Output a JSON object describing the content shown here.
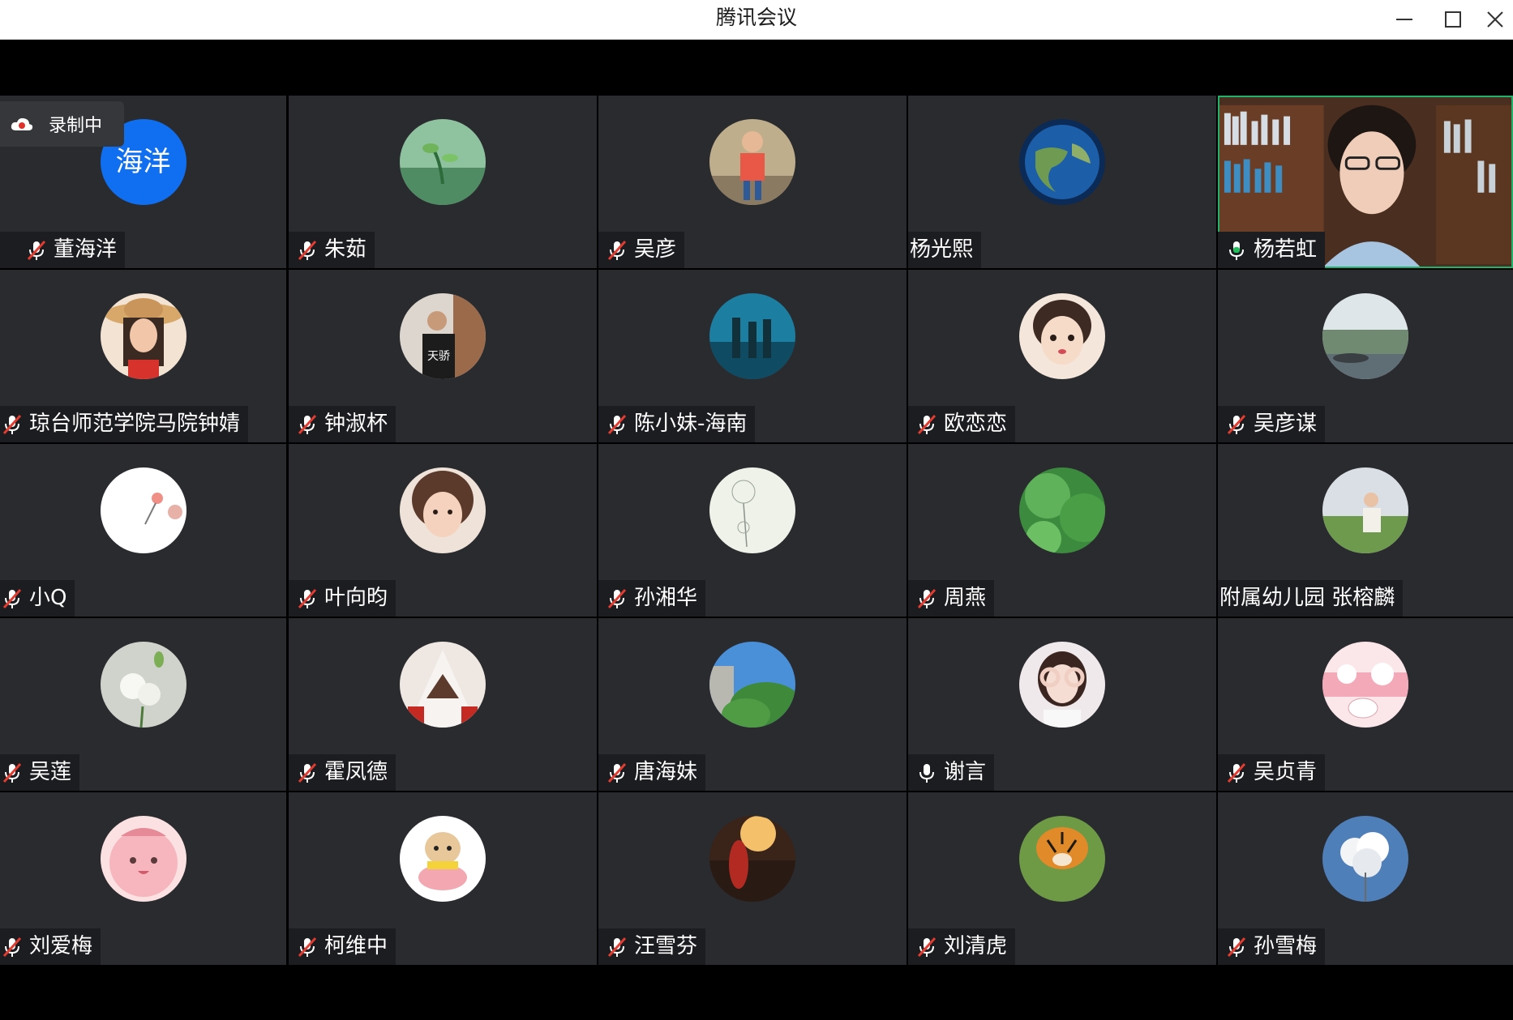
{
  "window": {
    "title": "腾讯会议"
  },
  "recording": {
    "label": "录制中"
  },
  "participants": [
    {
      "name": "董海洋",
      "mic": "muted",
      "avatar": "text-avatar",
      "avatar_text": "海洋",
      "avatar_color": "#0f6ff0"
    },
    {
      "name": "朱茹",
      "mic": "muted",
      "avatar": "plant-photo"
    },
    {
      "name": "吴彦",
      "mic": "muted",
      "avatar": "child-photo"
    },
    {
      "name": "杨光熙",
      "mic": "none",
      "avatar": "earth-photo"
    },
    {
      "name": "杨若虹",
      "mic": "speaking",
      "avatar": "video-feed"
    },
    {
      "name": "琼台师范学院马院钟婧",
      "mic": "muted",
      "avatar": "woman-hat-photo"
    },
    {
      "name": "钟淑杯",
      "mic": "muted",
      "avatar": "person-stairs-photo"
    },
    {
      "name": "陈小妹-海南",
      "mic": "muted",
      "avatar": "aquarium-photo"
    },
    {
      "name": "欧恋恋",
      "mic": "muted",
      "avatar": "girl-face-photo"
    },
    {
      "name": "吴彦谋",
      "mic": "muted",
      "avatar": "landscape-photo"
    },
    {
      "name": "小Q",
      "mic": "muted",
      "avatar": "flower-drawing"
    },
    {
      "name": "叶向昀",
      "mic": "muted",
      "avatar": "girl-photo"
    },
    {
      "name": "孙湘华",
      "mic": "muted",
      "avatar": "dandelion-drawing"
    },
    {
      "name": "周燕",
      "mic": "muted",
      "avatar": "lotus-leaf-photo"
    },
    {
      "name": "附属幼儿园 张榕麟",
      "mic": "none",
      "avatar": "woman-field-photo"
    },
    {
      "name": "吴莲",
      "mic": "muted",
      "avatar": "white-flowers-photo"
    },
    {
      "name": "霍凤德",
      "mic": "muted",
      "avatar": "assassin-character"
    },
    {
      "name": "唐海妹",
      "mic": "muted",
      "avatar": "tree-sky-photo"
    },
    {
      "name": "谢言",
      "mic": "unmuted",
      "avatar": "girl-hands-photo"
    },
    {
      "name": "吴贞青",
      "mic": "muted",
      "avatar": "cat-drawing"
    },
    {
      "name": "刘爱梅",
      "mic": "muted",
      "avatar": "pink-character"
    },
    {
      "name": "柯维中",
      "mic": "muted",
      "avatar": "dog-cartoon"
    },
    {
      "name": "汪雪芬",
      "mic": "muted",
      "avatar": "sunset-photo"
    },
    {
      "name": "刘清虎",
      "mic": "muted",
      "avatar": "tiger-photo"
    },
    {
      "name": "孙雪梅",
      "mic": "muted",
      "avatar": "cloud-photo"
    }
  ]
}
